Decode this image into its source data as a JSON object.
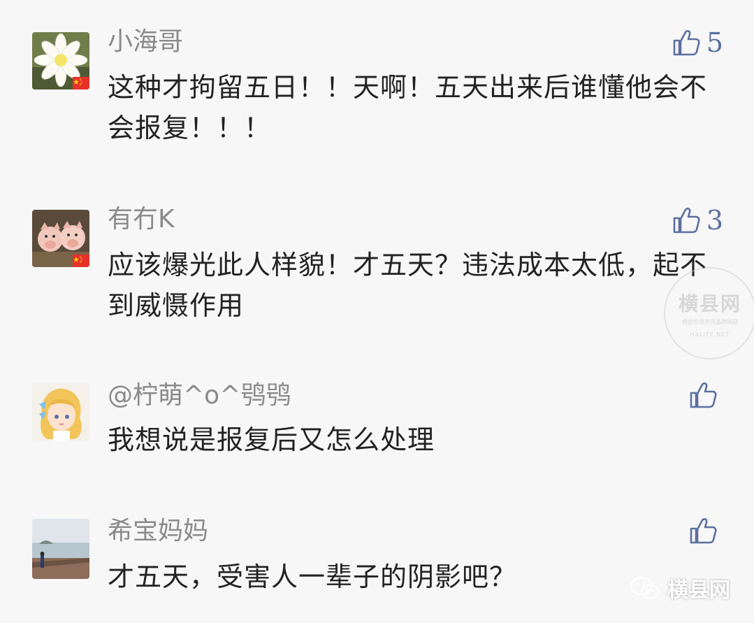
{
  "comments": [
    {
      "name": "小海哥",
      "text": "这种才拘留五日！！天啊！五天出来后谁懂他会不会报复！！！",
      "likes": "5",
      "avatar": "white-flower",
      "flag": true
    },
    {
      "name": "有冇K",
      "text": "应该爆光此人样貌！才五天？违法成本太低，起不到威慑作用",
      "likes": "3",
      "avatar": "two-piglets",
      "flag": true
    },
    {
      "name": "@柠萌^o^鸮鸮",
      "text": "我想说是报复后又怎么处理",
      "likes": "",
      "avatar": "anime-girl",
      "flag": false
    },
    {
      "name": "希宝妈妈",
      "text": "才五天，受害人一辈子的阴影吧？",
      "likes": "",
      "avatar": "seaside-photo",
      "flag": false
    }
  ],
  "watermark": {
    "main": "横县网",
    "sub": "横县生活资讯品牌网站",
    "url": "HXLIFE.NET"
  },
  "brand": {
    "label": "横县网",
    "icon": "wechat-icon"
  },
  "colors": {
    "background": "#f7f7f7",
    "name": "#8a8a8a",
    "text": "#222222",
    "like": "#5b6fa0"
  }
}
